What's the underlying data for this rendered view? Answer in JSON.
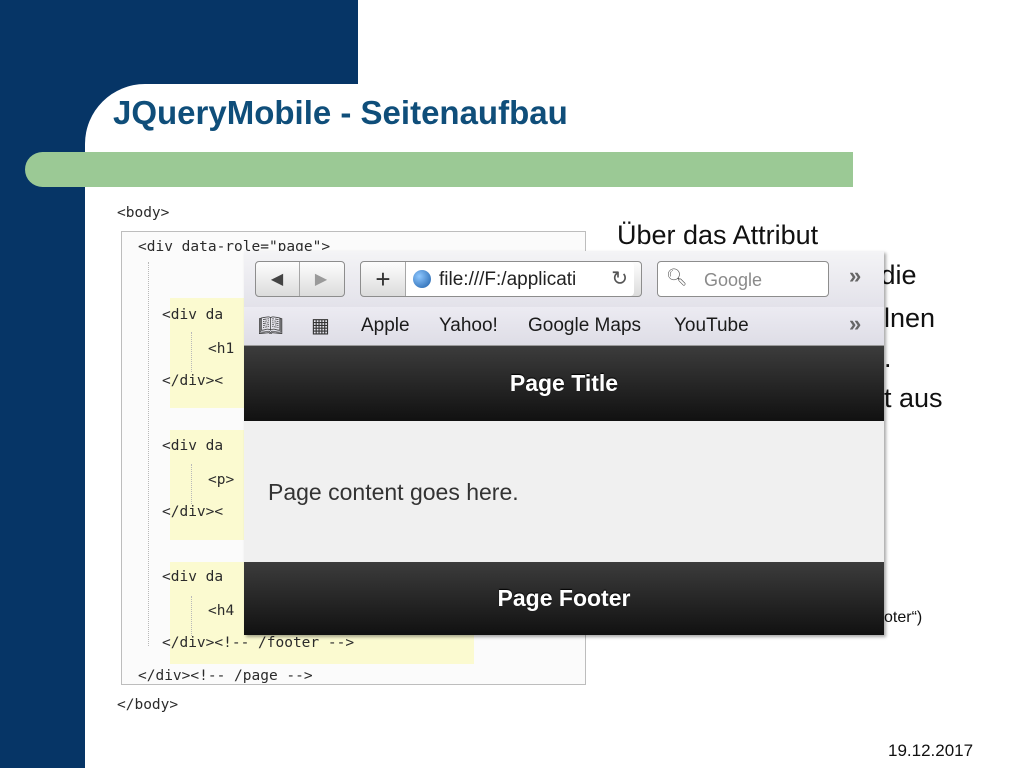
{
  "slide": {
    "title": "JQueryMobile - Seitenaufbau",
    "date": "19.12.2017",
    "body_line1": "Über das Attribut",
    "frag_1": "n die",
    "frag_2": "lnen",
    "frag_3": ".",
    "frag_4": "t aus",
    "frag_footer": "oter“)"
  },
  "code": {
    "line_body_open": "<body>",
    "line_div_page": "<div data-role=\"page\">",
    "line_div_1": "<div da",
    "line_h1": "<h1",
    "line_close_1": "</div><",
    "line_div_2": "<div da",
    "line_p": "<p>",
    "line_close_2": "</div><",
    "line_div_3": "<div da",
    "line_h4": "<h4",
    "line_close_footer": "</div><!-- /footer -->",
    "line_close_page": "</div><!-- /page -->",
    "line_body_close": "</body>"
  },
  "browser": {
    "url": "file:///F:/applicati",
    "search_placeholder": "Google",
    "back_icon": "◀",
    "forward_icon": "▶",
    "reload_icon": "↻",
    "overflow_icon": "»",
    "bookmarks": [
      "Apple",
      "Yahoo!",
      "Google Maps",
      "YouTube"
    ]
  },
  "app": {
    "header_title": "Page Title",
    "content_text": "Page content goes here.",
    "footer_title": "Page Footer"
  }
}
